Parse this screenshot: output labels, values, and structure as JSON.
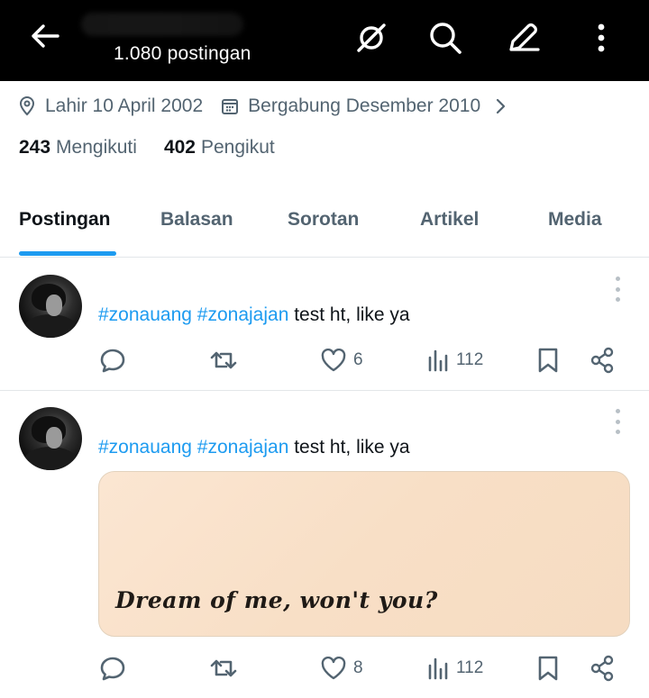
{
  "header": {
    "post_count": "1.080 postingan",
    "icons": [
      "back-arrow-icon",
      "no-sync-icon",
      "search-icon",
      "edit-icon",
      "more-vertical-icon"
    ]
  },
  "profile": {
    "birth": "Lahir 10 April 2002",
    "joined": "Bergabung Desember 2010",
    "following_count": "243",
    "following_label": "Mengikuti",
    "followers_count": "402",
    "followers_label": "Pengikut"
  },
  "tabs": [
    {
      "label": "Postingan",
      "active": true
    },
    {
      "label": "Balasan"
    },
    {
      "label": "Sorotan"
    },
    {
      "label": "Artikel"
    },
    {
      "label": "Media"
    }
  ],
  "posts": [
    {
      "hashtag1": "#zonauang",
      "hashtag2": "#zonajajan",
      "text": " test ht, like ya",
      "likes": "6",
      "views": "112"
    },
    {
      "hashtag1": "#zonauang",
      "hashtag2": "#zonajajan",
      "text": " test ht, like ya",
      "media_text": "Dream of me, won't you?",
      "likes": "8",
      "views": "112"
    }
  ],
  "colors": {
    "accent": "#1d9bf0",
    "muted": "#536471",
    "text": "#0f1419",
    "header_bg": "#000000",
    "media_bg": "#f8dfc6"
  }
}
